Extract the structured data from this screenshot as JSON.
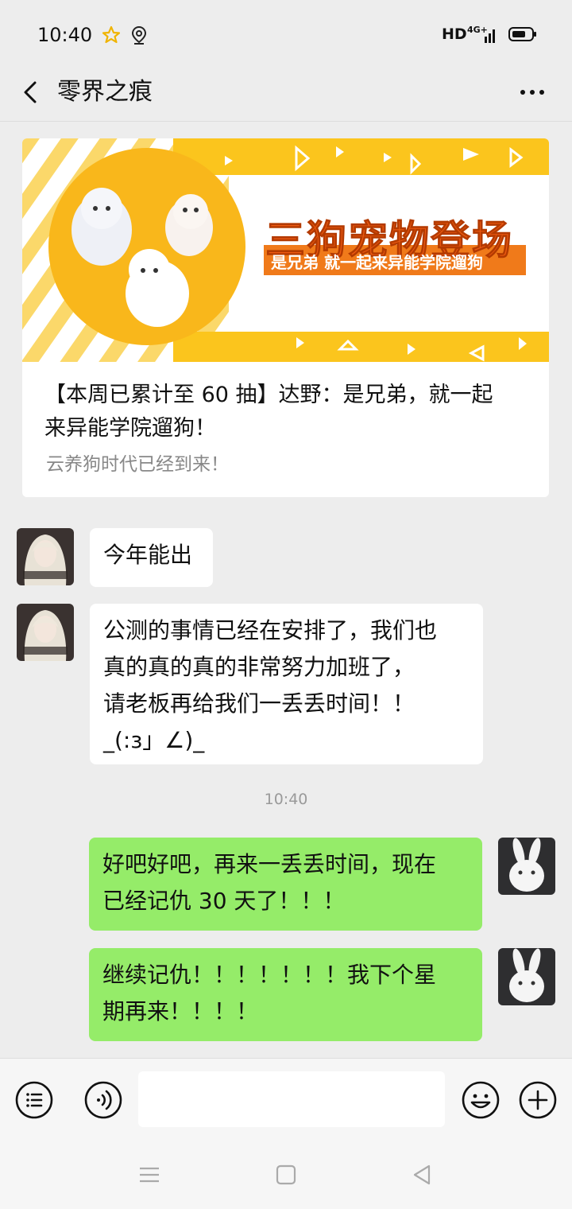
{
  "status_bar": {
    "time": "10:40",
    "network": "HD",
    "network_type": "4G+",
    "icons": [
      "star-icon",
      "location-icon",
      "signal-icon",
      "battery-icon"
    ]
  },
  "header": {
    "title": "零界之痕",
    "back_icon": "chevron-left-icon",
    "more_icon": "more-dots-icon"
  },
  "article": {
    "banner_title": "三狗宠物登场",
    "banner_subtitle": "是兄弟 就一起来异能学院遛狗",
    "title_line1": "【本周已累计至 60 抽】达野：是兄弟，就一起",
    "title_line2": "来异能学院遛狗！",
    "summary": "云养狗时代已经到来！"
  },
  "messages": [
    {
      "from": "other",
      "lines": [
        "今年能出"
      ]
    },
    {
      "from": "other",
      "lines": [
        "公测的事情已经在安排了，我们也",
        "真的真的真的非常努力加班了，",
        "请老板再给我们一丢丢时间！！",
        "_(:з」∠)_"
      ]
    },
    {
      "from": "me",
      "lines": [
        "好吧好吧，再来一丢丢时间，现在",
        "已经记仇 30 天了！！！"
      ]
    },
    {
      "from": "me",
      "lines": [
        "继续记仇！！！！！！！我下个星",
        "期再来！！！！"
      ]
    }
  ],
  "timestamp": "10:40",
  "composer": {
    "icons": [
      "menu-list-icon",
      "voice-icon",
      "emoji-icon",
      "plus-icon"
    ]
  },
  "system_nav": {
    "icons": [
      "recent-apps-icon",
      "home-icon",
      "back-triangle-icon"
    ]
  },
  "colors": {
    "background": "#ededed",
    "outgoing_bubble": "#95ec69",
    "incoming_bubble": "#ffffff",
    "banner_yellow": "#fbc51d",
    "banner_orange": "#f07a1a"
  }
}
